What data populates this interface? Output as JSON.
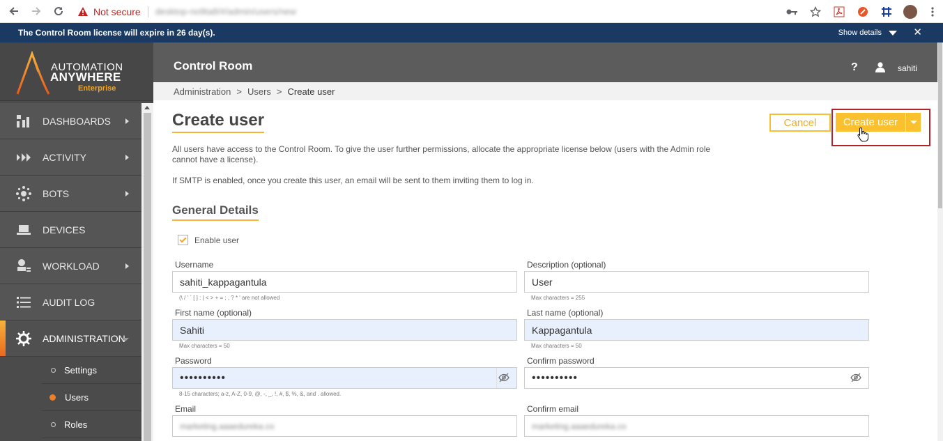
{
  "browser": {
    "not_secure": "Not secure",
    "url": "desktop-no9ta8/#/admin/users/new"
  },
  "license": {
    "message": "The Control Room license will expire in 26 day(s).",
    "show_details": "Show details"
  },
  "logo": {
    "line1": "AUTOMATION",
    "line2": "ANYWHERE",
    "line3": "Enterprise"
  },
  "sidebar": {
    "items": [
      {
        "label": "DASHBOARDS",
        "icon": "dashboards-icon"
      },
      {
        "label": "ACTIVITY",
        "icon": "activity-icon"
      },
      {
        "label": "BOTS",
        "icon": "bots-icon"
      },
      {
        "label": "DEVICES",
        "icon": "devices-icon"
      },
      {
        "label": "WORKLOAD",
        "icon": "workload-icon"
      },
      {
        "label": "AUDIT LOG",
        "icon": "audit-log-icon"
      },
      {
        "label": "ADMINISTRATION",
        "icon": "administration-icon"
      }
    ],
    "subitems": [
      {
        "label": "Settings"
      },
      {
        "label": "Users"
      },
      {
        "label": "Roles"
      }
    ]
  },
  "header": {
    "title": "Control Room",
    "username": "sahiti"
  },
  "breadcrumb": {
    "items": [
      "Administration",
      "Users",
      "Create user"
    ],
    "separator": ">"
  },
  "page": {
    "title": "Create user",
    "cancel": "Cancel",
    "create": "Create user",
    "description": "All users have access to the Control Room. To give the user further permissions, allocate the appropriate license below (users with the Admin role cannot have a license).",
    "smtp_note": "If SMTP is enabled, once you create this user, an email will be sent to them inviting them to log in.",
    "section": "General Details",
    "enable_user": "Enable user"
  },
  "form": {
    "username": {
      "label": "Username",
      "value": "sahiti_kappagantula",
      "hint": "(\\ / ' ` [ ] : | < > + = ; , ? * ' are not allowed"
    },
    "description": {
      "label": "Description (optional)",
      "value": "User",
      "hint": "Max characters = 255"
    },
    "first_name": {
      "label": "First name (optional)",
      "value": "Sahiti",
      "hint": "Max characters = 50"
    },
    "last_name": {
      "label": "Last name (optional)",
      "value": "Kappagantula",
      "hint": "Max characters = 50"
    },
    "password": {
      "label": "Password",
      "value": "••••••••••",
      "hint": "8-15 characters; a-z, A-Z, 0-9, @, -, _, !, #, $, %, &, and . allowed."
    },
    "confirm_password": {
      "label": "Confirm password",
      "value": "••••••••••"
    },
    "email": {
      "label": "Email",
      "value": "marketing.aaaedureka.co"
    },
    "confirm_email": {
      "label": "Confirm email",
      "value": "marketing.aaaedureka.co"
    }
  },
  "colors": {
    "banner": "#1b3a63",
    "accent": "#fbc02d",
    "sidebar": "#4b4b4b",
    "highlight": "#b2242a"
  }
}
